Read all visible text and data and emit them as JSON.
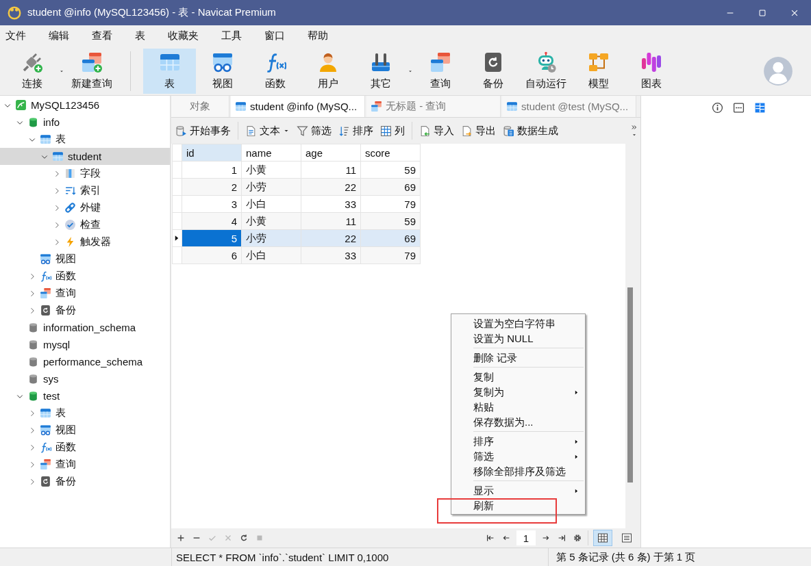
{
  "window": {
    "title": "student @info (MySQL123456) - 表 - Navicat Premium"
  },
  "menu": [
    "文件",
    "编辑",
    "查看",
    "表",
    "收藏夹",
    "工具",
    "窗口",
    "帮助"
  ],
  "toolbar": {
    "groups": [
      [
        {
          "label": "连接",
          "kind": "connect",
          "selected": false,
          "dropdown": true
        },
        {
          "label": "新建查询",
          "kind": "new_query",
          "selected": false,
          "dropdown": false
        }
      ],
      [
        {
          "label": "表",
          "kind": "table",
          "selected": true,
          "dropdown": false
        },
        {
          "label": "视图",
          "kind": "view",
          "selected": false,
          "dropdown": false
        },
        {
          "label": "函数",
          "kind": "function",
          "selected": false,
          "dropdown": false
        },
        {
          "label": "用户",
          "kind": "user",
          "selected": false,
          "dropdown": false
        },
        {
          "label": "其它",
          "kind": "other",
          "selected": false,
          "dropdown": true
        },
        {
          "label": "查询",
          "kind": "query",
          "selected": false,
          "dropdown": false
        },
        {
          "label": "备份",
          "kind": "backup",
          "selected": false,
          "dropdown": false
        },
        {
          "label": "自动运行",
          "kind": "automation",
          "selected": false,
          "dropdown": false
        },
        {
          "label": "模型",
          "kind": "model",
          "selected": false,
          "dropdown": false
        },
        {
          "label": "图表",
          "kind": "chart",
          "selected": false,
          "dropdown": false
        }
      ]
    ]
  },
  "sidebar": {
    "tree": [
      {
        "label": "MySQL123456",
        "kind": "connection",
        "expanded": true,
        "selected": false,
        "children": [
          {
            "label": "info",
            "kind": "database",
            "open": true,
            "expanded": true,
            "selected": false,
            "children": [
              {
                "label": "表",
                "kind": "tables",
                "expanded": true,
                "selected": false,
                "children": [
                  {
                    "label": "student",
                    "kind": "table",
                    "expanded": true,
                    "selected": true,
                    "children": [
                      {
                        "label": "字段",
                        "kind": "fields",
                        "expanded": false,
                        "selected": false
                      },
                      {
                        "label": "索引",
                        "kind": "index",
                        "expanded": false,
                        "selected": false
                      },
                      {
                        "label": "外键",
                        "kind": "foreign_key",
                        "expanded": false,
                        "selected": false
                      },
                      {
                        "label": "检查",
                        "kind": "check",
                        "expanded": false,
                        "selected": false
                      },
                      {
                        "label": "触发器",
                        "kind": "trigger",
                        "expanded": false,
                        "selected": false
                      }
                    ]
                  }
                ]
              },
              {
                "label": "视图",
                "kind": "views",
                "selected": false
              },
              {
                "label": "函数",
                "kind": "functions",
                "expanded": false,
                "selected": false
              },
              {
                "label": "查询",
                "kind": "queries",
                "expanded": false,
                "selected": false
              },
              {
                "label": "备份",
                "kind": "backups",
                "expanded": false,
                "selected": false
              }
            ]
          },
          {
            "label": "information_schema",
            "kind": "database",
            "open": false,
            "selected": false
          },
          {
            "label": "mysql",
            "kind": "database",
            "open": false,
            "selected": false
          },
          {
            "label": "performance_schema",
            "kind": "database",
            "open": false,
            "selected": false
          },
          {
            "label": "sys",
            "kind": "database",
            "open": false,
            "selected": false
          },
          {
            "label": "test",
            "kind": "database",
            "open": true,
            "expanded": true,
            "selected": false,
            "children": [
              {
                "label": "表",
                "kind": "tables",
                "expanded": false,
                "selected": false
              },
              {
                "label": "视图",
                "kind": "views",
                "expanded": false,
                "selected": false
              },
              {
                "label": "函数",
                "kind": "functions",
                "expanded": false,
                "selected": false
              },
              {
                "label": "查询",
                "kind": "queries",
                "expanded": false,
                "selected": false
              },
              {
                "label": "备份",
                "kind": "backups",
                "expanded": false,
                "selected": false
              }
            ]
          }
        ]
      }
    ]
  },
  "tabs": [
    {
      "label": "对象",
      "kind": "objects",
      "selected": false
    },
    {
      "label": "student @info (MySQ...",
      "kind": "table",
      "selected": true
    },
    {
      "label": "无标题 - 查询",
      "kind": "query",
      "selected": false
    },
    {
      "label": "student @test (MySQ...",
      "kind": "table",
      "selected": false
    }
  ],
  "data_toolbar": {
    "groups": [
      [
        {
          "label": "开始事务",
          "kind": "transaction",
          "dropdown": false
        }
      ],
      [
        {
          "label": "文本",
          "kind": "text",
          "dropdown": true
        },
        {
          "label": "筛选",
          "kind": "filter",
          "dropdown": false
        },
        {
          "label": "排序",
          "kind": "sort",
          "dropdown": false
        },
        {
          "label": "列",
          "kind": "columns",
          "dropdown": false
        }
      ],
      [
        {
          "label": "导入",
          "kind": "import",
          "dropdown": false
        },
        {
          "label": "导出",
          "kind": "export",
          "dropdown": false
        },
        {
          "label": "数据生成",
          "kind": "generate",
          "dropdown": false
        }
      ]
    ]
  },
  "table": {
    "columns": [
      {
        "name": "id",
        "kind": "number",
        "selected": true
      },
      {
        "name": "name",
        "kind": "text",
        "selected": false
      },
      {
        "name": "age",
        "kind": "number",
        "selected": false
      },
      {
        "name": "score",
        "kind": "number",
        "selected": false
      }
    ],
    "rows": [
      {
        "cells": [
          "1",
          "小黄",
          "11",
          "59"
        ],
        "selected": false
      },
      {
        "cells": [
          "2",
          "小劳",
          "22",
          "69"
        ],
        "selected": false
      },
      {
        "cells": [
          "3",
          "小白",
          "33",
          "79"
        ],
        "selected": false
      },
      {
        "cells": [
          "4",
          "小黄",
          "11",
          "59"
        ],
        "selected": false
      },
      {
        "cells": [
          "5",
          "小劳",
          "22",
          "69"
        ],
        "selected": true
      },
      {
        "cells": [
          "6",
          "小白",
          "33",
          "79"
        ],
        "selected": false
      }
    ]
  },
  "record_buttons": [
    {
      "kind": "add",
      "disabled": false
    },
    {
      "kind": "delete",
      "disabled": false
    },
    {
      "kind": "apply",
      "disabled": true
    },
    {
      "kind": "discard",
      "disabled": true
    },
    {
      "kind": "refresh",
      "disabled": false
    },
    {
      "kind": "stop",
      "disabled": true
    }
  ],
  "pager": {
    "page": "1"
  },
  "view_modes": [
    {
      "kind": "grid",
      "selected": true
    },
    {
      "kind": "form",
      "selected": false
    }
  ],
  "info_panel": {
    "buttons": [
      {
        "kind": "info",
        "selected": false
      },
      {
        "kind": "ddl",
        "selected": false
      },
      {
        "kind": "layout",
        "selected": true
      }
    ]
  },
  "context_menu": {
    "groups": [
      [
        {
          "label": "设置为空白字符串",
          "submenu": false
        },
        {
          "label": "设置为 NULL",
          "submenu": false
        }
      ],
      [
        {
          "label": "删除 记录",
          "submenu": false
        }
      ],
      [
        {
          "label": "复制",
          "submenu": false
        },
        {
          "label": "复制为",
          "submenu": true
        },
        {
          "label": "粘贴",
          "submenu": false
        },
        {
          "label": "保存数据为...",
          "submenu": false
        }
      ],
      [
        {
          "label": "排序",
          "submenu": true
        },
        {
          "label": "筛选",
          "submenu": true
        },
        {
          "label": "移除全部排序及筛选",
          "submenu": false
        }
      ],
      [
        {
          "label": "显示",
          "submenu": true
        },
        {
          "label": "刷新",
          "submenu": false
        }
      ]
    ]
  },
  "highlight_box": true,
  "status_bar": {
    "query": "SELECT * FROM `info`.`student` LIMIT 0,1000",
    "records": "第 5 条记录 (共 6 条) 于第 1 页"
  }
}
